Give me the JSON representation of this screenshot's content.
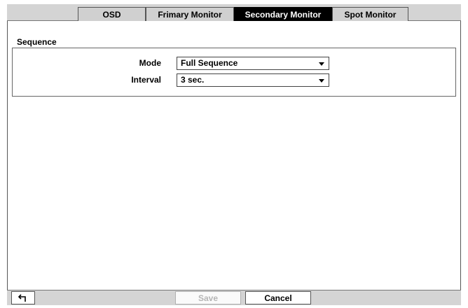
{
  "tabs": [
    {
      "label": "OSD",
      "active": false
    },
    {
      "label": "Frimary Monitor",
      "active": false
    },
    {
      "label": "Secondary Monitor",
      "active": true
    },
    {
      "label": "Spot Monitor",
      "active": false
    }
  ],
  "sequence": {
    "title": "Sequence",
    "mode": {
      "label": "Mode",
      "value": "Full Sequence"
    },
    "interval": {
      "label": "Interval",
      "value": "3 sec."
    }
  },
  "footer": {
    "back_icon": "return-arrow-icon",
    "save_label": "Save",
    "cancel_label": "Cancel"
  },
  "colors": {
    "active_tab_bg": "#000000",
    "bar_bg": "#d4d4d4",
    "disabled_text": "#b5b5b5"
  }
}
